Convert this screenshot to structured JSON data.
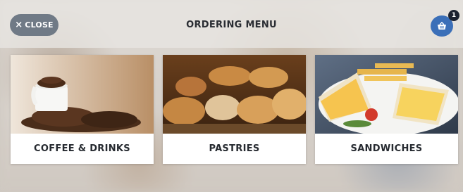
{
  "header": {
    "close_label": "CLOSE",
    "close_icon": "×",
    "title": "ORDERING MENU",
    "cart_icon": "basket-icon",
    "cart_count": "1"
  },
  "categories": [
    {
      "label": "COFFEE & DRINKS",
      "image": "coffee-cup-with-beans-photo"
    },
    {
      "label": "PASTRIES",
      "image": "pastries-assortment-photo"
    },
    {
      "label": "SANDWICHES",
      "image": "sandwiches-plate-photo"
    }
  ],
  "colors": {
    "accent_blue": "#3b6fb8",
    "close_button": "#707a86",
    "badge": "#1c2230"
  }
}
